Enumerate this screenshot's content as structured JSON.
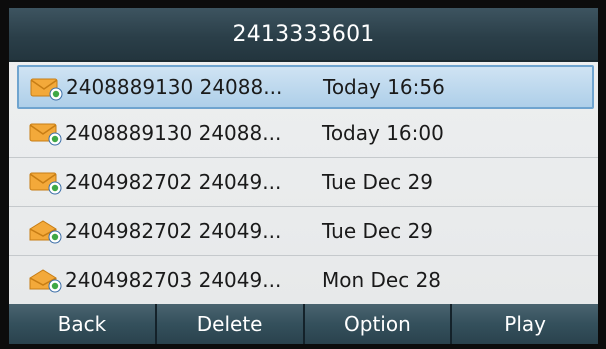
{
  "header": {
    "title": "2413333601"
  },
  "messages": [
    {
      "number": "2408889130 24088...",
      "date": "Today 16:56",
      "icon": "voicemail-envelope-icon",
      "selected": true
    },
    {
      "number": "2408889130 24088...",
      "date": "Today 16:00",
      "icon": "voicemail-envelope-icon",
      "selected": false
    },
    {
      "number": "2404982702 24049...",
      "date": "Tue Dec 29",
      "icon": "voicemail-envelope-icon",
      "selected": false
    },
    {
      "number": "2404982702 24049...",
      "date": "Tue Dec 29",
      "icon": "voicemail-opened-icon",
      "selected": false
    },
    {
      "number": "2404982703 24049...",
      "date": "Mon Dec 28",
      "icon": "voicemail-opened-icon",
      "selected": false
    }
  ],
  "softkeys": {
    "back": "Back",
    "delete": "Delete",
    "option": "Option",
    "play": "Play"
  },
  "colors": {
    "title_bar": "#2b3f49",
    "selection": "#aecfe9",
    "icon_orange": "#f0a030",
    "icon_green": "#3fa845"
  }
}
